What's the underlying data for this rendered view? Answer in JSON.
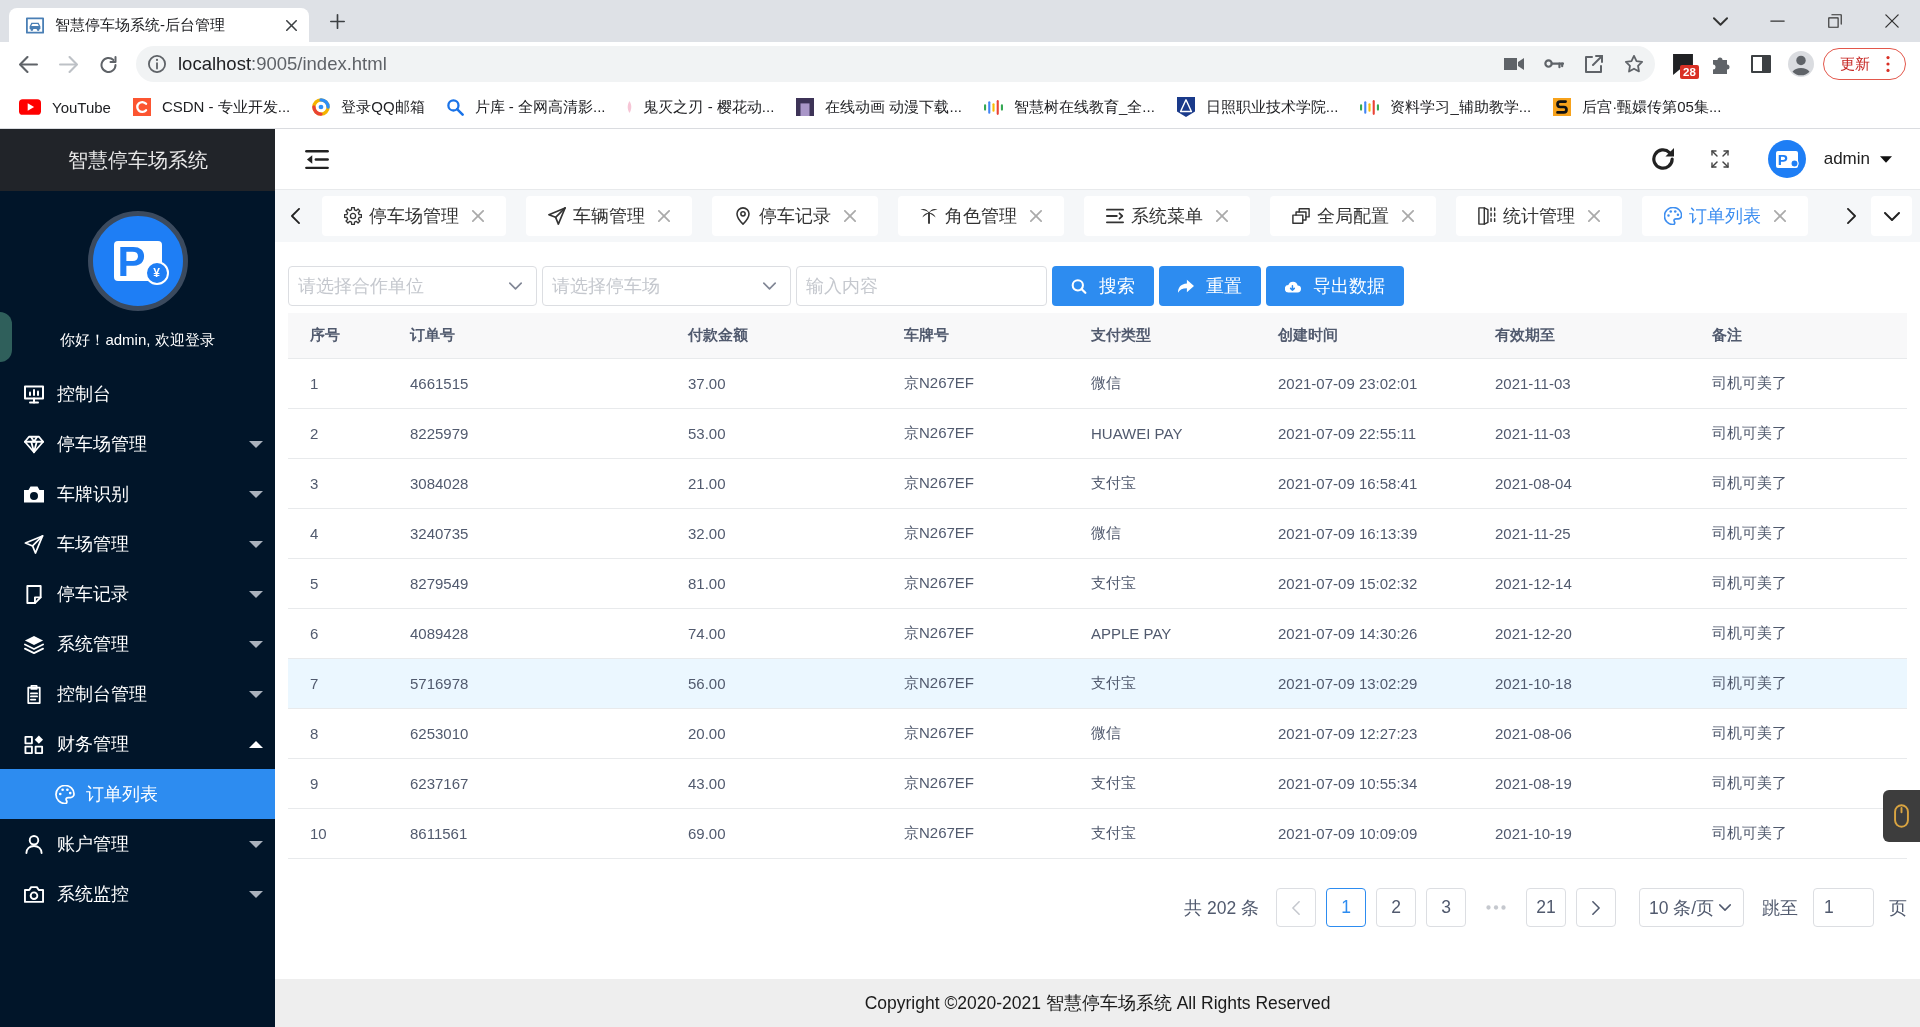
{
  "browser": {
    "tab": {
      "title": "智慧停车场系统-后台管理"
    },
    "address": {
      "host": "localhost",
      "path": ":9005/index.html"
    },
    "extension_badge": "28",
    "update_button": "更新",
    "bookmarks": [
      {
        "label": "YouTube"
      },
      {
        "label": "CSDN - 专业开发..."
      },
      {
        "label": "登录QQ邮箱"
      },
      {
        "label": "片库 - 全网高清影..."
      },
      {
        "label": "鬼灭之刃 - 樱花动..."
      },
      {
        "label": "在线动画 动漫下载..."
      },
      {
        "label": "智慧树在线教育_全..."
      },
      {
        "label": "日照职业技术学院..."
      },
      {
        "label": "资料学习_辅助教学..."
      },
      {
        "label": "后宫·甄嬛传第05集..."
      }
    ]
  },
  "sidebar": {
    "title": "智慧停车场系统",
    "logo": {
      "letter": "P",
      "currency": "¥"
    },
    "greeting": "你好！admin, 欢迎登录",
    "menu": [
      {
        "label": "控制台",
        "selected": false
      },
      {
        "label": "停车场管理",
        "selected": false,
        "expanded": false
      },
      {
        "label": "车牌识别",
        "selected": false,
        "expanded": false
      },
      {
        "label": "车场管理",
        "selected": false,
        "expanded": false
      },
      {
        "label": "停车记录",
        "selected": false,
        "expanded": false
      },
      {
        "label": "系统管理",
        "selected": false,
        "expanded": false
      },
      {
        "label": "控制台管理",
        "selected": false,
        "expanded": false
      },
      {
        "label": "财务管理",
        "selected": false,
        "expanded": true,
        "children": [
          {
            "label": "订单列表",
            "selected": true
          }
        ]
      },
      {
        "label": "账户管理",
        "selected": false,
        "expanded": false
      },
      {
        "label": "系统监控",
        "selected": false,
        "expanded": false
      }
    ]
  },
  "header": {
    "logo": {
      "letter": "P"
    },
    "user": "admin"
  },
  "tabs": [
    {
      "label": "停车场管理",
      "selected": false
    },
    {
      "label": "车辆管理",
      "selected": false
    },
    {
      "label": "停车记录",
      "selected": false
    },
    {
      "label": "角色管理",
      "selected": false
    },
    {
      "label": "系统菜单",
      "selected": false
    },
    {
      "label": "全局配置",
      "selected": false
    },
    {
      "label": "统计管理",
      "selected": false
    },
    {
      "label": "订单列表",
      "selected": true
    }
  ],
  "filters": {
    "unit_select": {
      "placeholder": "请选择合作单位"
    },
    "lot_select": {
      "placeholder": "请选择停车场"
    },
    "keyword_field": {
      "placeholder": "输入内容"
    },
    "buttons": [
      "搜索",
      "重置",
      "导出数据"
    ]
  },
  "table": {
    "columns": [
      "序号",
      "订单号",
      "付款金额",
      "车牌号",
      "支付类型",
      "创建时间",
      "有效期至",
      "备注"
    ],
    "rows": [
      {
        "cells": [
          "1",
          "4661515",
          "37.00",
          "京N267EF",
          "微信",
          "2021-07-09 23:02:01",
          "2021-11-03",
          "司机可美了"
        ],
        "selected": false
      },
      {
        "cells": [
          "2",
          "8225979",
          "53.00",
          "京N267EF",
          "HUAWEI PAY",
          "2021-07-09 22:55:11",
          "2021-11-03",
          "司机可美了"
        ],
        "selected": false
      },
      {
        "cells": [
          "3",
          "3084028",
          "21.00",
          "京N267EF",
          "支付宝",
          "2021-07-09 16:58:41",
          "2021-08-04",
          "司机可美了"
        ],
        "selected": false
      },
      {
        "cells": [
          "4",
          "3240735",
          "32.00",
          "京N267EF",
          "微信",
          "2021-07-09 16:13:39",
          "2021-11-25",
          "司机可美了"
        ],
        "selected": false
      },
      {
        "cells": [
          "5",
          "8279549",
          "81.00",
          "京N267EF",
          "支付宝",
          "2021-07-09 15:02:32",
          "2021-12-14",
          "司机可美了"
        ],
        "selected": false
      },
      {
        "cells": [
          "6",
          "4089428",
          "74.00",
          "京N267EF",
          "APPLE PAY",
          "2021-07-09 14:30:26",
          "2021-12-20",
          "司机可美了"
        ],
        "selected": false
      },
      {
        "cells": [
          "7",
          "5716978",
          "56.00",
          "京N267EF",
          "支付宝",
          "2021-07-09 13:02:29",
          "2021-10-18",
          "司机可美了"
        ],
        "selected": true
      },
      {
        "cells": [
          "8",
          "6253010",
          "20.00",
          "京N267EF",
          "微信",
          "2021-07-09 12:27:23",
          "2021-08-06",
          "司机可美了"
        ],
        "selected": false
      },
      {
        "cells": [
          "9",
          "6237167",
          "43.00",
          "京N267EF",
          "支付宝",
          "2021-07-09 10:55:34",
          "2021-08-19",
          "司机可美了"
        ],
        "selected": false
      },
      {
        "cells": [
          "10",
          "8611561",
          "69.00",
          "京N267EF",
          "支付宝",
          "2021-07-09 10:09:09",
          "2021-10-19",
          "司机可美了"
        ],
        "selected": false
      }
    ]
  },
  "pagination": {
    "total": "共 202 条",
    "prev": {
      "disabled": true
    },
    "pages": [
      {
        "kind": "page",
        "label": "1",
        "selected": true
      },
      {
        "kind": "page",
        "label": "2",
        "selected": false
      },
      {
        "kind": "page",
        "label": "3",
        "selected": false
      },
      {
        "kind": "more"
      },
      {
        "kind": "page",
        "label": "21",
        "selected": false
      }
    ],
    "next": {
      "disabled": false
    },
    "page_size": "10 条/页",
    "jump_label": "跳至",
    "jump_value": "1",
    "page_unit": "页"
  },
  "footer": {
    "text": "Copyright ©2020-2021 智慧停车场系统 All Rights Reserved"
  }
}
